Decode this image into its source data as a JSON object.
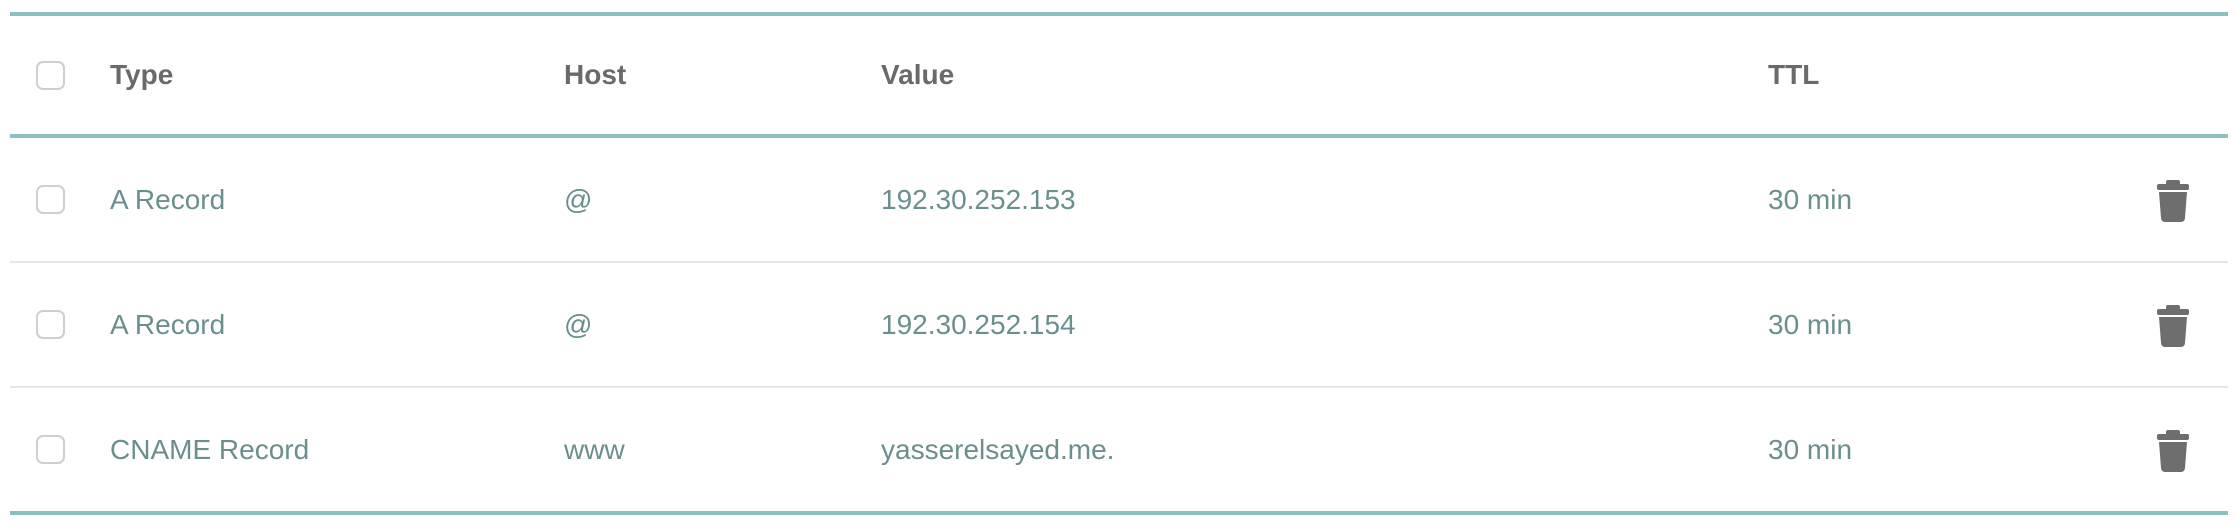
{
  "colors": {
    "accent_rule": "#8cbfc0",
    "row_divider": "#e6e6e6",
    "header_text": "#6a6a6a",
    "cell_text": "#6b8f8e",
    "icon": "#6e6e6e"
  },
  "table": {
    "columns": {
      "type": "Type",
      "host": "Host",
      "value": "Value",
      "ttl": "TTL"
    },
    "rows": [
      {
        "type": "A Record",
        "host": "@",
        "value": "192.30.252.153",
        "ttl": "30 min",
        "action_icon": "trash-icon"
      },
      {
        "type": "A Record",
        "host": "@",
        "value": "192.30.252.154",
        "ttl": "30 min",
        "action_icon": "trash-icon"
      },
      {
        "type": "CNAME Record",
        "host": "www",
        "value": "yasserelsayed.me.",
        "ttl": "30 min",
        "action_icon": "trash-icon"
      }
    ]
  }
}
